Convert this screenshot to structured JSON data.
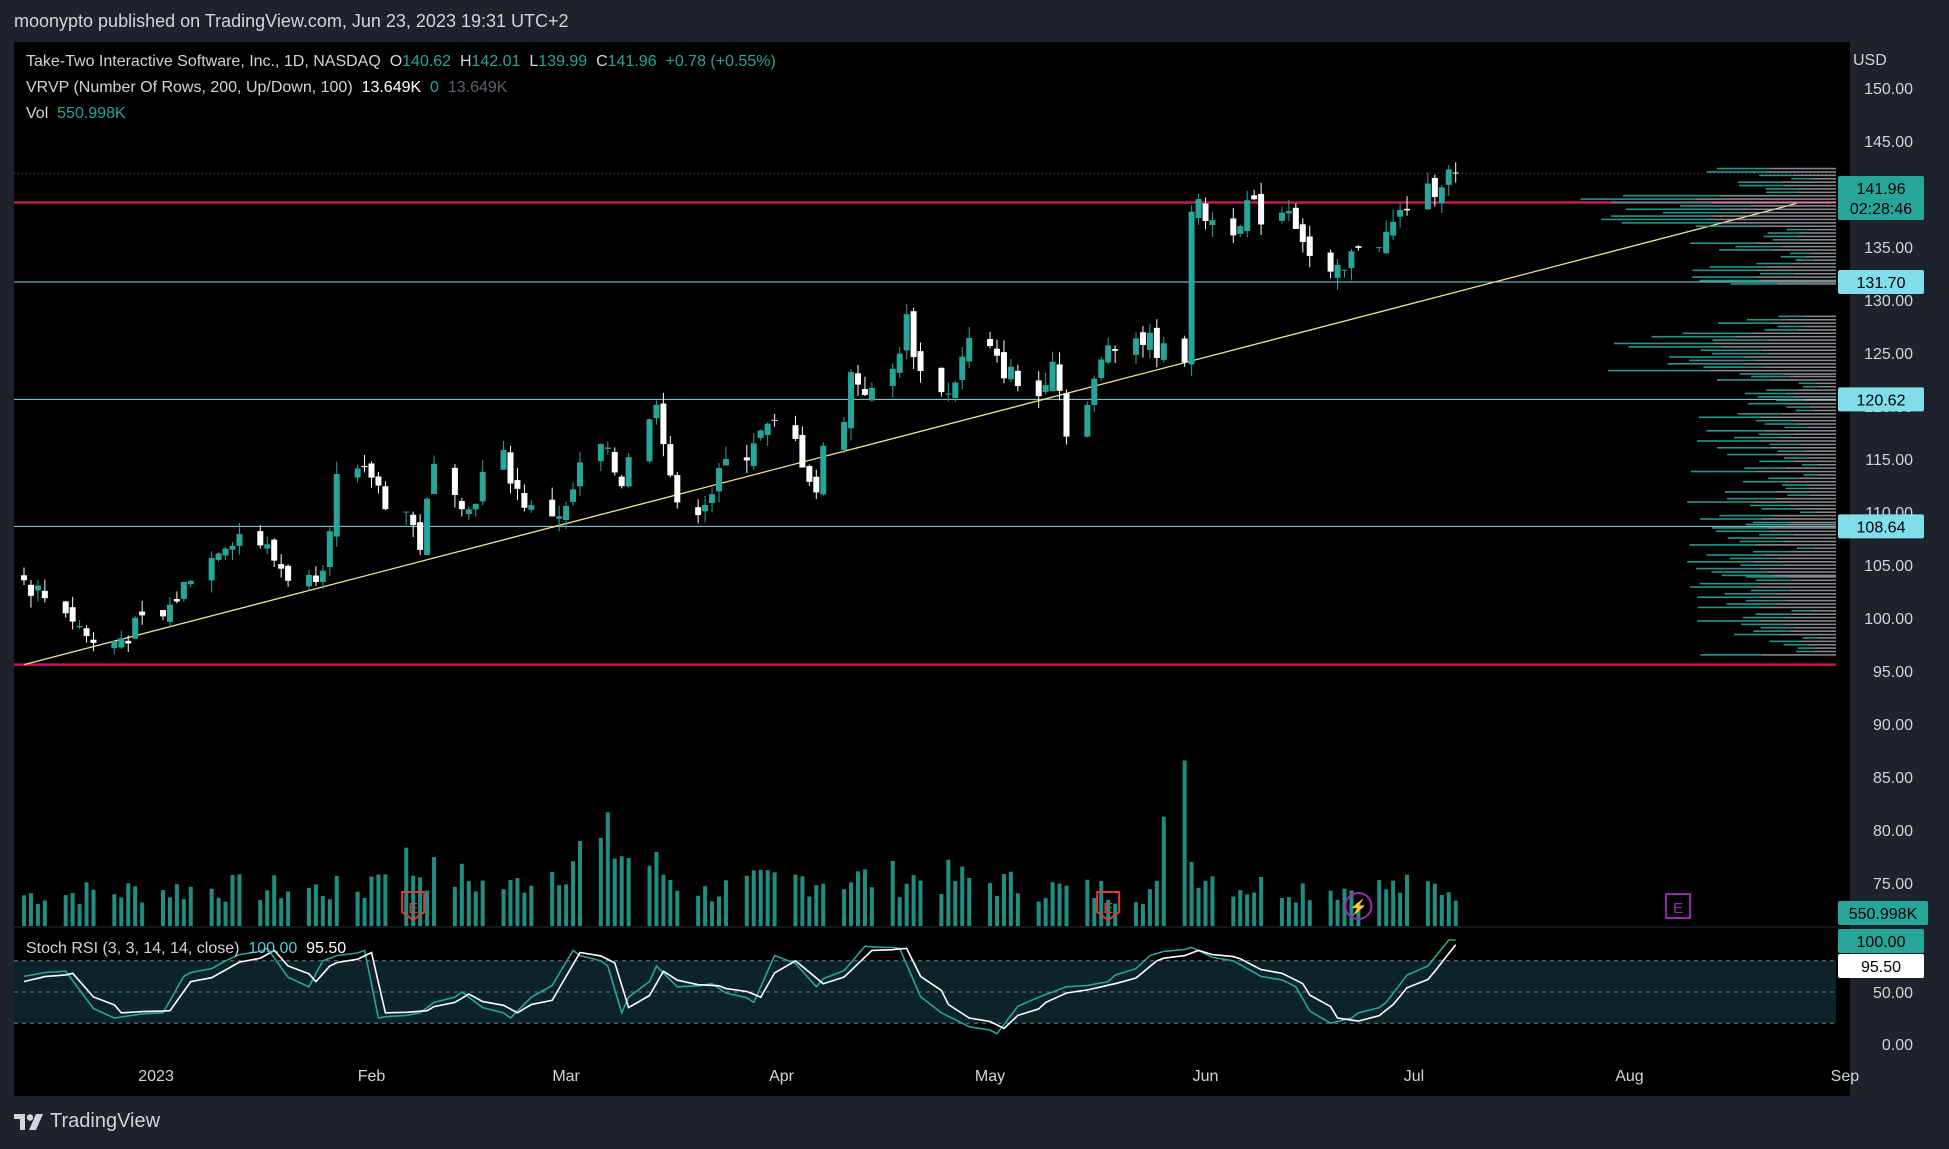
{
  "header": {
    "published": "moonypto published on TradingView.com, Jun 23, 2023 19:31 UTC+2"
  },
  "footer": {
    "logo_text": "TradingView"
  },
  "legend": {
    "symbol": "Take-Two Interactive Software, Inc., 1D, NASDAQ",
    "o_label": "O",
    "o_value": "140.62",
    "h_label": "H",
    "h_value": "142.01",
    "l_label": "L",
    "l_value": "139.99",
    "c_label": "C",
    "c_value": "141.96",
    "change": "+0.78 (+0.55%)",
    "vrvp_label": "VRVP (Number Of Rows, 200, Up/Down, 100)",
    "vrvp_v1": "13.649K",
    "vrvp_v2": "0",
    "vrvp_v3": "13.649K",
    "vol_label": "Vol",
    "vol_value": "550.998K",
    "stoch_label": "Stoch RSI (3, 3, 14, 14, close)",
    "stoch_k": "100.00",
    "stoch_d": "95.50"
  },
  "currency": "USD",
  "colors": {
    "background": "#000000",
    "up": "#26a69a",
    "down": "#ffffff",
    "resistance": "#c2185b",
    "support": "#80deea",
    "trendline": "#f0e68c",
    "badge_price": "#26a69a",
    "badge_level": "#80deea",
    "earnings": "#e53935",
    "event_purple": "#9c27b0"
  },
  "badges": {
    "last_price": "141.96",
    "countdown": "02:28:46",
    "level_131": "131.70",
    "level_120": "120.62",
    "level_108": "108.64",
    "volume": "550.998K",
    "stoch_k": "100.00",
    "stoch_d": "95.50"
  },
  "markers": {
    "earnings_letter": "E",
    "dividend_symbol": "⚡"
  },
  "chart_data": {
    "type": "candlestick",
    "price_axis": {
      "ylim": [
        92.5,
        155
      ],
      "ticks": [
        "150.00",
        "145.00",
        "140.00",
        "135.00",
        "130.00",
        "125.00",
        "120.00",
        "115.00",
        "110.00",
        "105.00",
        "100.00",
        "95.00",
        "90.00",
        "85.00",
        "80.00",
        "75.00"
      ]
    },
    "stoch_axis": {
      "ylim": [
        0,
        100
      ],
      "ticks": [
        "50.00",
        "0.00"
      ],
      "bands": [
        20,
        80
      ]
    },
    "x_axis": {
      "labels": [
        {
          "label": "2023",
          "date": "2023-01-01"
        },
        {
          "label": "Feb",
          "date": "2023-02-01"
        },
        {
          "label": "Mar",
          "date": "2023-03-01"
        },
        {
          "label": "Apr",
          "date": "2023-04-01"
        },
        {
          "label": "May",
          "date": "2023-05-01"
        },
        {
          "label": "Jun",
          "date": "2023-06-01"
        },
        {
          "label": "Jul",
          "date": "2023-07-01"
        },
        {
          "label": "Aug",
          "date": "2023-08-01"
        },
        {
          "label": "Sep",
          "date": "2023-09-01"
        }
      ]
    },
    "start_date": "2022-12-13",
    "trading_days": 130,
    "close_anchors": [
      [
        0,
        103.5
      ],
      [
        3,
        102
      ],
      [
        5,
        100
      ],
      [
        8,
        97.5
      ],
      [
        11,
        98.5
      ],
      [
        14,
        100
      ],
      [
        17,
        103
      ],
      [
        20,
        107
      ],
      [
        23,
        108
      ],
      [
        26,
        105.5
      ],
      [
        29,
        103.5
      ],
      [
        31,
        105.5
      ],
      [
        33,
        113
      ],
      [
        36,
        113.5
      ],
      [
        39,
        110
      ],
      [
        41,
        107
      ],
      [
        43,
        114
      ],
      [
        46,
        110
      ],
      [
        49,
        115
      ],
      [
        51,
        112
      ],
      [
        53,
        110
      ],
      [
        56,
        110
      ],
      [
        59,
        116
      ],
      [
        62,
        113
      ],
      [
        65,
        121
      ],
      [
        68,
        110
      ],
      [
        71,
        112
      ],
      [
        75,
        117
      ],
      [
        78,
        118
      ],
      [
        82,
        112
      ],
      [
        85,
        123
      ],
      [
        88,
        121
      ],
      [
        91,
        128
      ],
      [
        93,
        123
      ],
      [
        95,
        121
      ],
      [
        98,
        126
      ],
      [
        100,
        124
      ],
      [
        102,
        123
      ],
      [
        104,
        121
      ],
      [
        106,
        125
      ],
      [
        108,
        118
      ],
      [
        112,
        126
      ],
      [
        114,
        126.5
      ],
      [
        116,
        126
      ],
      [
        118,
        125
      ],
      [
        119,
        125
      ],
      [
        120,
        139
      ],
      [
        122,
        138
      ],
      [
        124,
        137
      ],
      [
        126,
        139
      ],
      [
        128,
        138
      ],
      [
        130,
        139
      ],
      [
        132,
        136
      ],
      [
        134,
        132
      ],
      [
        136,
        132.5
      ],
      [
        138,
        135.5
      ],
      [
        140,
        136
      ],
      [
        142,
        138
      ],
      [
        144,
        140
      ],
      [
        146,
        141.5
      ],
      [
        148,
        142
      ]
    ],
    "volume_million_anchors": [
      [
        0,
        1.3
      ],
      [
        20,
        1.6
      ],
      [
        35,
        1.5
      ],
      [
        38,
        3.0
      ],
      [
        40,
        2.4
      ],
      [
        50,
        1.6
      ],
      [
        60,
        3.5
      ],
      [
        70,
        1.4
      ],
      [
        80,
        2.0
      ],
      [
        95,
        2.0
      ],
      [
        108,
        1.5
      ],
      [
        117,
        1.5
      ],
      [
        118,
        3.6
      ],
      [
        119,
        9.7
      ],
      [
        120,
        2.7
      ],
      [
        125,
        1.7
      ],
      [
        135,
        1.6
      ],
      [
        145,
        1.6
      ]
    ],
    "vol_range_million": [
      0,
      10.5
    ],
    "horizontal_levels": [
      {
        "price": 139.2,
        "kind": "resistance"
      },
      {
        "price": 131.7,
        "kind": "support"
      },
      {
        "price": 120.62,
        "kind": "support"
      },
      {
        "price": 108.64,
        "kind": "support"
      },
      {
        "price": 95.6,
        "kind": "resistance"
      }
    ],
    "trendline": [
      [
        "2022-12-13",
        95.6
      ],
      [
        "2023-08-25",
        139.1
      ]
    ],
    "earnings_dates": [
      "2023-02-07",
      "2023-05-18"
    ],
    "future_earnings_date": "2023-08-08",
    "dividend_date": "2023-06-23",
    "stoch_k_anchors": [
      [
        0,
        65
      ],
      [
        4,
        70
      ],
      [
        9,
        25
      ],
      [
        14,
        30
      ],
      [
        17,
        65
      ],
      [
        21,
        80
      ],
      [
        25,
        92
      ],
      [
        29,
        55
      ],
      [
        31,
        80
      ],
      [
        35,
        90
      ],
      [
        37,
        25
      ],
      [
        41,
        30
      ],
      [
        45,
        50
      ],
      [
        50,
        25
      ],
      [
        53,
        45
      ],
      [
        57,
        90
      ],
      [
        60,
        75
      ],
      [
        62,
        30
      ],
      [
        65,
        75
      ],
      [
        68,
        55
      ],
      [
        71,
        58
      ],
      [
        75,
        40
      ],
      [
        78,
        85
      ],
      [
        82,
        55
      ],
      [
        87,
        94
      ],
      [
        90,
        92
      ],
      [
        94,
        30
      ],
      [
        97,
        20
      ],
      [
        100,
        10
      ],
      [
        104,
        45
      ],
      [
        108,
        55
      ],
      [
        112,
        60
      ],
      [
        116,
        85
      ],
      [
        120,
        93
      ],
      [
        124,
        80
      ],
      [
        128,
        65
      ],
      [
        131,
        55
      ],
      [
        134,
        20
      ],
      [
        137,
        25
      ],
      [
        140,
        40
      ],
      [
        144,
        75
      ],
      [
        147,
        100
      ]
    ],
    "stoch_d_anchors": [
      [
        0,
        60
      ],
      [
        5,
        68
      ],
      [
        10,
        30
      ],
      [
        15,
        32
      ],
      [
        18,
        60
      ],
      [
        22,
        75
      ],
      [
        26,
        90
      ],
      [
        30,
        60
      ],
      [
        32,
        75
      ],
      [
        36,
        88
      ],
      [
        38,
        30
      ],
      [
        42,
        32
      ],
      [
        46,
        48
      ],
      [
        51,
        30
      ],
      [
        54,
        42
      ],
      [
        58,
        88
      ],
      [
        61,
        78
      ],
      [
        63,
        35
      ],
      [
        66,
        70
      ],
      [
        69,
        57
      ],
      [
        72,
        56
      ],
      [
        76,
        45
      ],
      [
        79,
        80
      ],
      [
        83,
        58
      ],
      [
        88,
        90
      ],
      [
        91,
        92
      ],
      [
        95,
        38
      ],
      [
        98,
        25
      ],
      [
        101,
        15
      ],
      [
        105,
        40
      ],
      [
        109,
        52
      ],
      [
        113,
        58
      ],
      [
        117,
        80
      ],
      [
        121,
        90
      ],
      [
        125,
        82
      ],
      [
        129,
        68
      ],
      [
        132,
        58
      ],
      [
        135,
        25
      ],
      [
        138,
        22
      ],
      [
        141,
        38
      ],
      [
        145,
        70
      ],
      [
        148,
        95.5
      ]
    ],
    "volume_profile_ranges": [
      [
        96.5,
        104
      ],
      [
        104,
        109
      ],
      [
        109,
        123
      ],
      [
        123,
        128.5
      ],
      [
        131.5,
        142.5
      ]
    ]
  }
}
